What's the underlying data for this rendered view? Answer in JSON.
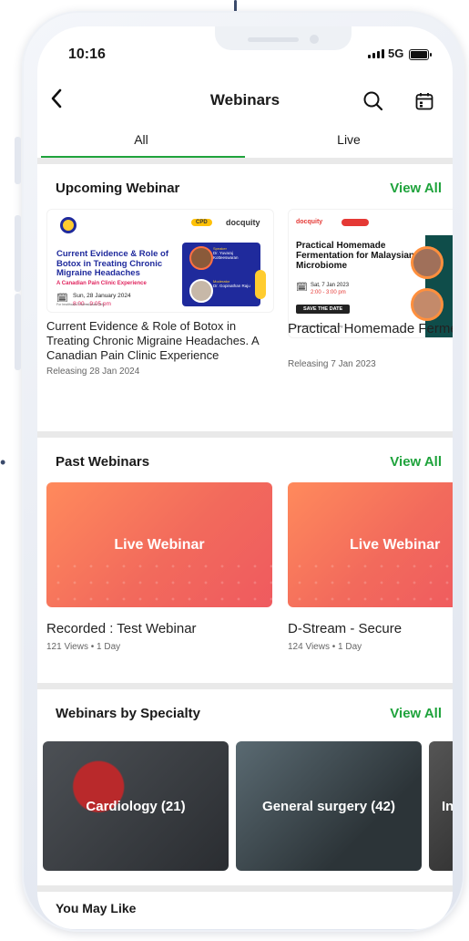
{
  "status": {
    "time": "10:16",
    "network": "5G"
  },
  "nav": {
    "title": "Webinars"
  },
  "tabs": [
    {
      "label": "All",
      "active": true
    },
    {
      "label": "Live",
      "active": false
    }
  ],
  "upcoming": {
    "title": "Upcoming Webinar",
    "view_all": "View All",
    "cards": [
      {
        "banner_heading": "Current Evidence & Role of Botox in Treating Chronic Migraine Headaches",
        "banner_subheading": "A Canadian Pain Clinic Experience",
        "banner_date": "Sun, 28 January 2024",
        "banner_time": "8:00 - 9:05 pm",
        "banner_brand": "docquity",
        "banner_badge": "CPD",
        "speaker_label": "Speaker",
        "speaker_name": "Dr. Yuvaraj Kotteeswaran",
        "moderator_label": "Moderator",
        "moderator_name": "Dr. Gopinathan Raju",
        "banner_footer": "For healthcare Professionals Only",
        "title": "Current Evidence & Role of Botox in Treating Chronic Migraine Headaches. A Canadian Pain Clinic Experience",
        "meta": "Releasing 28 Jan 2024"
      },
      {
        "banner_heading": "Practical Homemade Fermentation for Malaysian Microbiome",
        "banner_date": "Sat, 7 Jan 2023",
        "banner_time": "2:00 - 3:00 pm",
        "banner_cta": "SAVE THE DATE",
        "banner_brand": "docquity",
        "banner_footer": "For healthcare professionals only",
        "title": "Practical Homemade Fermentation for Malaysian Microbiome",
        "meta": "Releasing 7 Jan 2023"
      }
    ]
  },
  "past": {
    "title": "Past Webinars",
    "view_all": "View All",
    "cards": [
      {
        "thumb_label": "Live Webinar",
        "title": "Recorded  : Test Webinar",
        "meta": "121 Views • 1 Day"
      },
      {
        "thumb_label": "Live Webinar",
        "title": "D-Stream - Secure",
        "meta": "124 Views • 1 Day"
      }
    ]
  },
  "specialty": {
    "title": "Webinars by Specialty",
    "view_all": "View All",
    "items": [
      {
        "label": "Cardiology (21)"
      },
      {
        "label": "General surgery (42)"
      },
      {
        "label": "In"
      }
    ]
  },
  "you_may_like": {
    "title": "You May Like"
  },
  "colors": {
    "accent": "#1fa33c",
    "past_thumb": "#f26a5c",
    "banner_navy": "#1f2a9c"
  }
}
